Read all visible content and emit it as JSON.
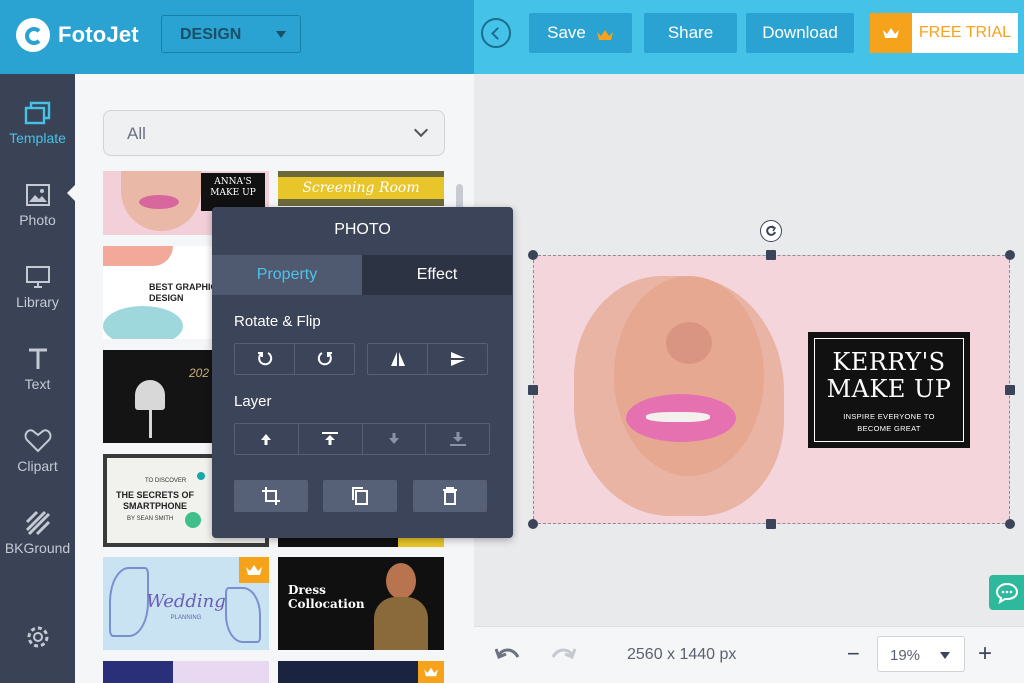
{
  "header": {
    "logo_text": "FotoJet",
    "design_select": "DESIGN",
    "save_label": "Save",
    "share_label": "Share",
    "download_label": "Download",
    "free_trial_label": "FREE TRIAL",
    "accent_color": "#45c2e8",
    "premium_color": "#f7a21b"
  },
  "leftnav": {
    "items": [
      {
        "label": "Template",
        "icon": "template-icon",
        "active": true
      },
      {
        "label": "Photo",
        "icon": "photo-icon"
      },
      {
        "label": "Library",
        "icon": "monitor-icon"
      },
      {
        "label": "Text",
        "icon": "text-icon"
      },
      {
        "label": "Clipart",
        "icon": "heart-icon"
      },
      {
        "label": "BKGround",
        "icon": "background-icon"
      }
    ],
    "settings_icon": "gear-icon"
  },
  "templates": {
    "filter_value": "All",
    "thumbs": [
      {
        "title": "ANNA'S MAKE UP"
      },
      {
        "title": "Screening Room"
      },
      {
        "title": "BEST GRAPHIC DESIGN"
      },
      {
        "title": "202"
      },
      {
        "title": "THE SECRETS OF SMARTPHONE",
        "top": "TO DISCOVER",
        "author": "BY SEAN SMITH"
      },
      {
        "title": "Wedding",
        "sub": "PLANNING",
        "premium": true
      },
      {
        "title": "Dress Collocation"
      }
    ]
  },
  "photo_panel": {
    "title": "PHOTO",
    "tabs": [
      "Property",
      "Effect"
    ],
    "active_tab": "Property",
    "rotate_flip_label": "Rotate & Flip",
    "layer_label": "Layer",
    "rotate_buttons": [
      "rotate-left-icon",
      "rotate-right-icon"
    ],
    "flip_buttons": [
      "flip-horizontal-icon",
      "flip-vertical-icon"
    ],
    "layer_buttons": [
      "bring-forward-icon",
      "bring-to-front-icon",
      "send-backward-icon",
      "send-to-back-icon"
    ],
    "action_buttons": [
      "crop-icon",
      "duplicate-icon",
      "delete-icon"
    ]
  },
  "canvas": {
    "brand_title_line1": "KERRY'S",
    "brand_title_line2": "MAKE UP",
    "brand_sub_line1": "INSPIRE EVERYONE TO",
    "brand_sub_line2": "BECOME GREAT"
  },
  "bottombar": {
    "dimensions": "2560 x 1440 px",
    "zoom": "19%",
    "undo_icon": "undo-icon",
    "redo_icon": "redo-icon",
    "zoom_out": "−",
    "zoom_in": "+"
  }
}
